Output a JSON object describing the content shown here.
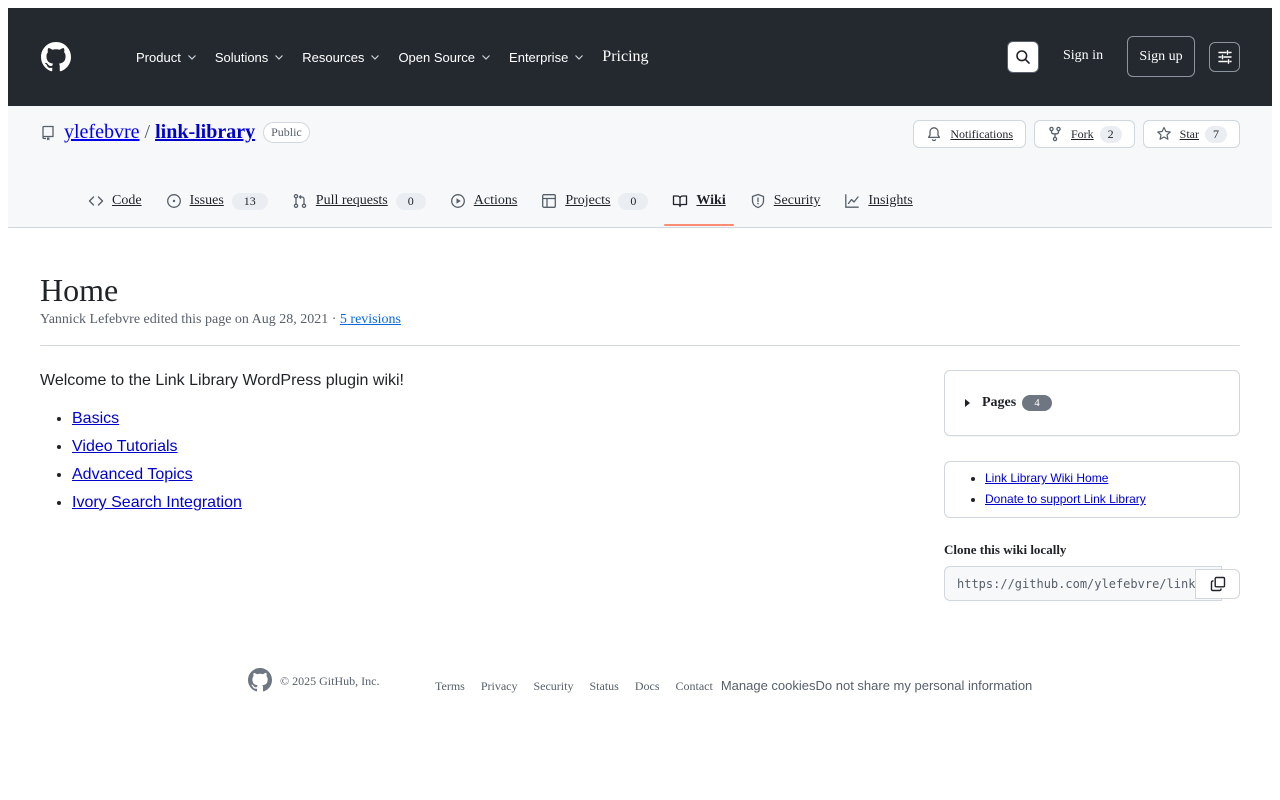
{
  "header": {
    "nav": [
      {
        "label": "Product"
      },
      {
        "label": "Solutions"
      },
      {
        "label": "Resources"
      },
      {
        "label": "Open Source"
      },
      {
        "label": "Enterprise"
      }
    ],
    "pricing": "Pricing",
    "sign_in": "Sign in",
    "sign_up": "Sign up"
  },
  "repo": {
    "owner": "ylefebvre",
    "slash": "/",
    "name": "link-library",
    "visibility": "Public",
    "notifications": "Notifications",
    "fork_label": "Fork",
    "fork_count": "2",
    "star_label": "Star",
    "star_count": "7"
  },
  "tabs": [
    {
      "label": "Code",
      "icon": "code-icon"
    },
    {
      "label": "Issues",
      "count": "13",
      "icon": "issue-icon"
    },
    {
      "label": "Pull requests",
      "count": "0",
      "icon": "pull-request-icon"
    },
    {
      "label": "Actions",
      "icon": "play-icon"
    },
    {
      "label": "Projects",
      "count": "0",
      "icon": "table-icon"
    },
    {
      "label": "Wiki",
      "icon": "book-icon",
      "active": true
    },
    {
      "label": "Security",
      "icon": "shield-icon"
    },
    {
      "label": "Insights",
      "icon": "graph-icon"
    }
  ],
  "wiki": {
    "title": "Home",
    "meta_text": "Yannick Lefebvre edited this page on Aug 28, 2021 · ",
    "revisions": "5 revisions",
    "intro": "Welcome to the Link Library WordPress plugin wiki!",
    "links": [
      "Basics",
      "Video Tutorials",
      "Advanced Topics",
      "Ivory Search Integration"
    ]
  },
  "sidebar": {
    "pages_label": "Pages",
    "pages_count": "4",
    "custom_links": [
      "Link Library Wiki Home",
      "Donate to support Link Library"
    ],
    "clone_label": "Clone this wiki locally",
    "clone_url": "https://github.com/ylefebvre/link-library.wiki.git"
  },
  "footer": {
    "copyright": "© 2025 GitHub, Inc.",
    "links": [
      "Terms",
      "Privacy",
      "Security",
      "Status",
      "Docs",
      "Contact"
    ],
    "manage_cookies": "Manage cookies",
    "do_not_share": "Do not share my personal information"
  },
  "colors": {
    "header_bg": "#24292f",
    "active_tab_underline": "#fd8c73",
    "link": "#0000cc"
  }
}
